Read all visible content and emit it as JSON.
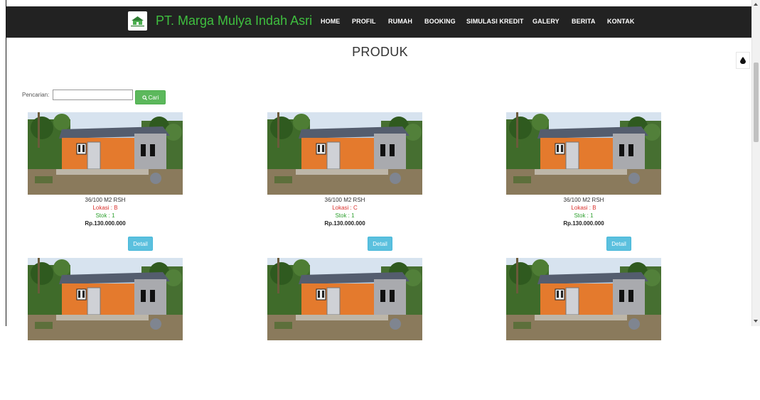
{
  "brand": {
    "name": "PT. Marga Mulya Indah Asri",
    "logo_icon": "house-logo-icon",
    "color": "#3fbf3f"
  },
  "nav": {
    "items": [
      {
        "label": "HOME"
      },
      {
        "label": "PROFIL"
      },
      {
        "label": "RUMAH"
      },
      {
        "label": "BOOKING"
      },
      {
        "label": "SIMULASI KREDIT"
      },
      {
        "label": "GALERY"
      },
      {
        "label": "BERITA"
      },
      {
        "label": "KONTAK"
      }
    ],
    "background": "#222222"
  },
  "page": {
    "title": "PRODUK"
  },
  "search": {
    "label": "Pencarian:",
    "value": "",
    "placeholder": "",
    "button_label": "Cari",
    "button_icon": "search-icon"
  },
  "theme_toggle": {
    "icon": "droplet-icon"
  },
  "products": [
    {
      "name": "36/100 M2 RSH",
      "location": "Lokasi : B",
      "stock": "Stok : 1",
      "price": "Rp.130.000.000",
      "button": "Detail"
    },
    {
      "name": "36/100 M2 RSH",
      "location": "Lokasi : C",
      "stock": "Stok : 1",
      "price": "Rp.130.000.000",
      "button": "Detail"
    },
    {
      "name": "36/100 M2 RSH",
      "location": "Lokasi : B",
      "stock": "Stok : 1",
      "price": "Rp.130.000.000",
      "button": "Detail"
    },
    {
      "name": "",
      "location": "",
      "stock": "",
      "price": "",
      "button": ""
    },
    {
      "name": "",
      "location": "",
      "stock": "",
      "price": "",
      "button": ""
    },
    {
      "name": "",
      "location": "",
      "stock": "",
      "price": "",
      "button": ""
    }
  ],
  "colors": {
    "accent_green": "#5cb85c",
    "info_blue": "#5bc0de",
    "location_red": "#d9302c",
    "stock_green": "#2ea02e"
  }
}
